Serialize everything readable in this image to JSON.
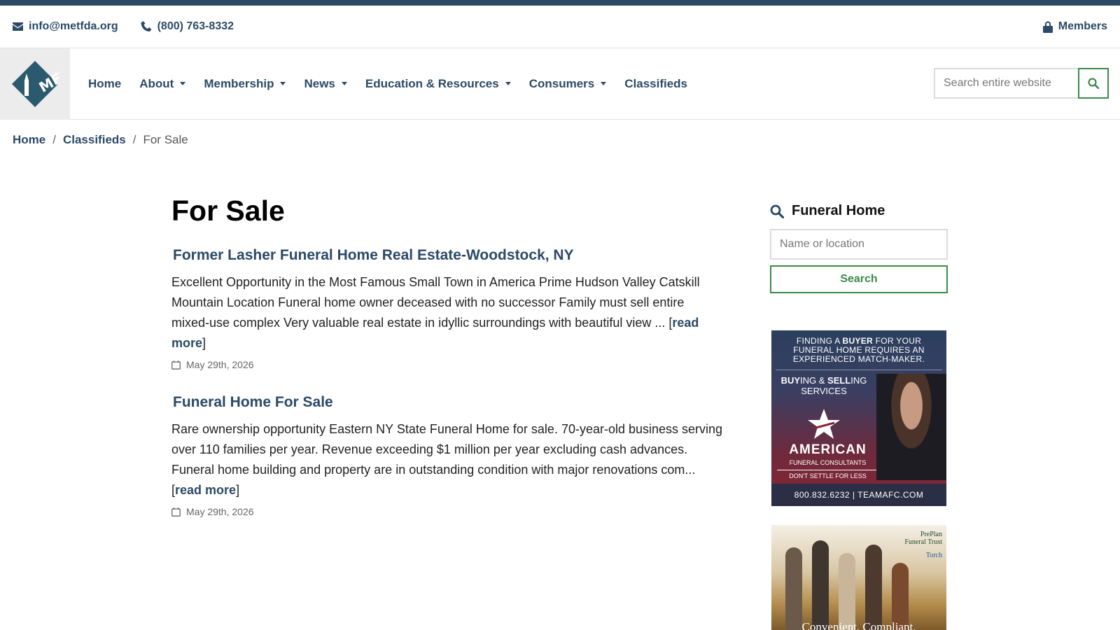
{
  "utility": {
    "email": "info@metfda.org",
    "phone": "(800) 763-8332",
    "members": "Members"
  },
  "nav": {
    "items": [
      {
        "label": "Home",
        "dropdown": false
      },
      {
        "label": "About",
        "dropdown": true
      },
      {
        "label": "Membership",
        "dropdown": true
      },
      {
        "label": "News",
        "dropdown": true
      },
      {
        "label": "Education & Resources",
        "dropdown": true
      },
      {
        "label": "Consumers",
        "dropdown": true
      },
      {
        "label": "Classifieds",
        "dropdown": false
      }
    ],
    "search_placeholder": "Search entire website"
  },
  "breadcrumb": {
    "home": "Home",
    "classifieds": "Classifieds",
    "current": "For Sale"
  },
  "main": {
    "title": "For Sale",
    "posts": [
      {
        "title": "Former Lasher Funeral Home Real Estate-Woodstock, NY",
        "body": "Excellent Opportunity in the Most Famous Small Town in America Prime Hudson Valley Catskill Mountain Location Funeral home owner deceased with no successor Family must sell entire mixed-use complex Very valuable real estate in idyllic surroundings with beautiful view ... [",
        "read_more": "read more",
        "close": "]",
        "date": "May 29th, 2026"
      },
      {
        "title": "Funeral Home For Sale",
        "body": "Rare ownership opportunity Eastern NY State Funeral Home for sale. 70-year-old business serving over 110 families per year. Revenue exceeding $1 million per year excluding cash advances. Funeral home building and property are in outstanding condition with major renovations com... [",
        "read_more": "read more",
        "close": "]",
        "date": "May 29th, 2026"
      }
    ]
  },
  "sidebar": {
    "heading": "Funeral Home",
    "input_placeholder": "Name or location",
    "button": "Search"
  },
  "ads": {
    "ad1": {
      "top_pre": "FINDING A ",
      "top_bold": "BUYER",
      "top_post": " FOR YOUR FUNERAL HOME REQUIRES AN EXPERIENCED MATCH-MAKER.",
      "buy_bold": "BUY",
      "buy_mid": "ING & ",
      "sell_bold": "SELL",
      "sell_post": "ING SERVICES",
      "brand": "AMERICAN",
      "brand_sub": "FUNERAL CONSULTANTS",
      "slogan": "DON'T SETTLE FOR LESS",
      "footer": "800.832.6232  |  TEAMAFC.COM"
    },
    "ad2": {
      "logo": "PrePlan",
      "logo_sub": "Funeral Trust",
      "logo2": "Torch",
      "tagline": "Convenient. Compliant."
    }
  },
  "colors": {
    "brand": "#2b4a66",
    "accent_green": "#3a8a4a"
  }
}
